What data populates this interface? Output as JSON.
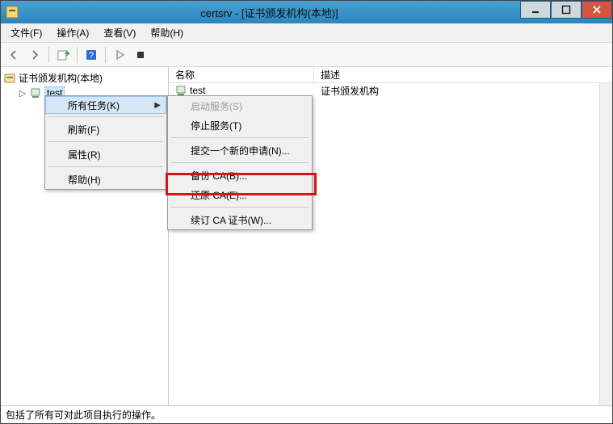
{
  "window": {
    "title": "certsrv - [证书颁发机构(本地)]"
  },
  "menubar": {
    "file": "文件(F)",
    "action": "操作(A)",
    "view": "查看(V)",
    "help": "帮助(H)"
  },
  "tree": {
    "root": "证书颁发机构(本地)",
    "child1": "test"
  },
  "columns": {
    "name": "名称",
    "description": "描述"
  },
  "list": {
    "row1": {
      "name": "test",
      "desc": "证书颁发机构"
    }
  },
  "ctx1": {
    "all_tasks": "所有任务(K)",
    "refresh": "刷新(F)",
    "properties": "属性(R)",
    "help": "帮助(H)"
  },
  "ctx2": {
    "start_service": "启动服务(S)",
    "stop_service": "停止服务(T)",
    "submit_req": "提交一个新的申请(N)...",
    "backup_ca": "备份 CA(B)...",
    "restore_ca": "还原 CA(E)...",
    "renew_cert": "续订 CA 证书(W)..."
  },
  "statusbar": {
    "text": "包括了所有可对此项目执行的操作。"
  }
}
